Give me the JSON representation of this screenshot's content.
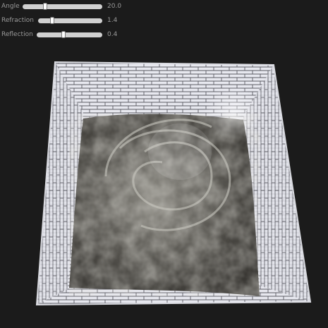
{
  "controls": [
    {
      "id": "angle",
      "label": "Angle",
      "value_text": "20.0",
      "fraction": 0.27
    },
    {
      "id": "refraction",
      "label": "Refraction",
      "value_text": "1.4",
      "fraction": 0.2
    },
    {
      "id": "reflection",
      "label": "Reflection",
      "value_text": "0.4",
      "fraction": 0.4
    }
  ],
  "colors": {
    "background": "#1b1b1b",
    "tile": "#e7e8ef",
    "grout": "#5a5a62",
    "water_dark": "#3a3834",
    "water_light": "#a7a59b"
  }
}
